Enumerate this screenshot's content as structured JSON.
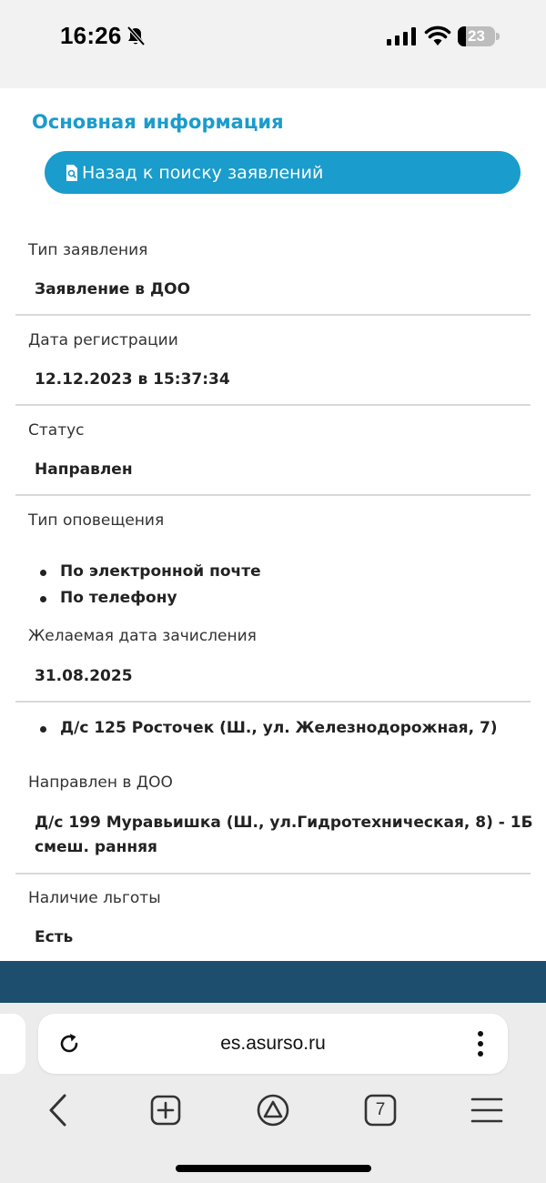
{
  "status_bar": {
    "time": "16:26",
    "battery_level": "23",
    "battery_fraction": 0.23
  },
  "page": {
    "section_title": "Основная информация",
    "back_button_label": "Назад к поиску заявлений",
    "fields": {
      "application_type": {
        "label": "Тип заявления",
        "value": "Заявление в ДОО"
      },
      "registration_date": {
        "label": "Дата регистрации",
        "value": "12.12.2023 в 15:37:34"
      },
      "status": {
        "label": "Статус",
        "value": "Направлен"
      },
      "notification_type": {
        "label": "Тип оповещения",
        "items": [
          "По электронной почте",
          "По телефону"
        ]
      },
      "desired_enrollment_date": {
        "label": "Желаемая дата зачисления",
        "value": "31.08.2025"
      },
      "preferred_institutions": {
        "items": [
          "Д/с 125 Росточек (Ш., ул. Железнодорожная, 7)"
        ]
      },
      "directed_to": {
        "label": "Направлен в ДОО",
        "value_line1": "Д/с 199 Муравьишка (Ш., ул.Гидротехническая, 8) - 1Б",
        "value_line2": "смеш. ранняя"
      },
      "benefit": {
        "label": "Наличие льготы",
        "value": "Есть"
      }
    }
  },
  "browser": {
    "url": "es.asurso.ru",
    "tab_count": "7"
  },
  "colors": {
    "accent": "#1a9ccc",
    "footer": "#1d4e6e"
  }
}
